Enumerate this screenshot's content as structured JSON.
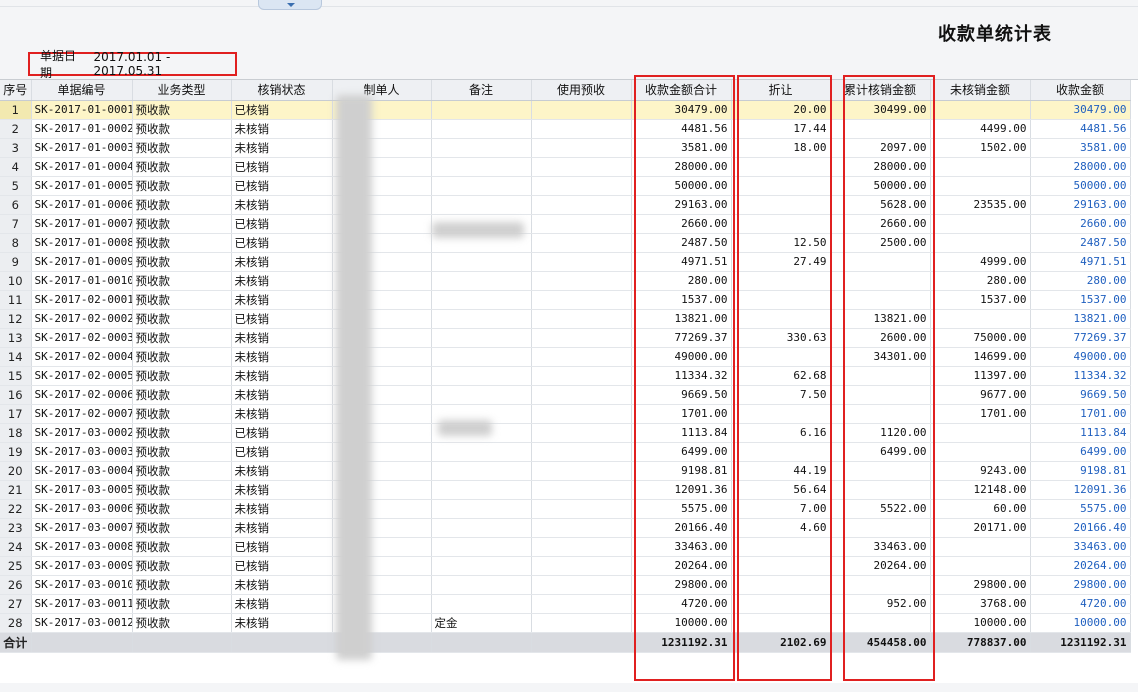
{
  "title": "收款单统计表",
  "filter": {
    "label": "单据日期",
    "value": "2017.01.01 - 2017.05.31"
  },
  "columns": [
    "序号",
    "单据编号",
    "业务类型",
    "核销状态",
    "制单人",
    "备注",
    "使用预收",
    "收款金额合计",
    "折让",
    "累计核销金额",
    "未核销金额",
    "收款金额"
  ],
  "rows": [
    {
      "seq": "1",
      "code": "SK-2017-01-0001",
      "type": "预收款",
      "status": "已核销",
      "maker": "",
      "note": "",
      "prepay": "",
      "total": "30479.00",
      "discount": "20.00",
      "verified": "30499.00",
      "unverified": "",
      "amount": "30479.00"
    },
    {
      "seq": "2",
      "code": "SK-2017-01-0002",
      "type": "预收款",
      "status": "未核销",
      "maker": "",
      "note": "",
      "prepay": "",
      "total": "4481.56",
      "discount": "17.44",
      "verified": "",
      "unverified": "4499.00",
      "amount": "4481.56"
    },
    {
      "seq": "3",
      "code": "SK-2017-01-0003",
      "type": "预收款",
      "status": "未核销",
      "maker": "",
      "note": "",
      "prepay": "",
      "total": "3581.00",
      "discount": "18.00",
      "verified": "2097.00",
      "unverified": "1502.00",
      "amount": "3581.00"
    },
    {
      "seq": "4",
      "code": "SK-2017-01-0004",
      "type": "预收款",
      "status": "已核销",
      "maker": "",
      "note": "",
      "prepay": "",
      "total": "28000.00",
      "discount": "",
      "verified": "28000.00",
      "unverified": "",
      "amount": "28000.00"
    },
    {
      "seq": "5",
      "code": "SK-2017-01-0005",
      "type": "预收款",
      "status": "已核销",
      "maker": "",
      "note": "",
      "prepay": "",
      "total": "50000.00",
      "discount": "",
      "verified": "50000.00",
      "unverified": "",
      "amount": "50000.00"
    },
    {
      "seq": "6",
      "code": "SK-2017-01-0006",
      "type": "预收款",
      "status": "未核销",
      "maker": "",
      "note": "",
      "prepay": "",
      "total": "29163.00",
      "discount": "",
      "verified": "5628.00",
      "unverified": "23535.00",
      "amount": "29163.00"
    },
    {
      "seq": "7",
      "code": "SK-2017-01-0007",
      "type": "预收款",
      "status": "已核销",
      "maker": "",
      "note": "",
      "prepay": "",
      "total": "2660.00",
      "discount": "",
      "verified": "2660.00",
      "unverified": "",
      "amount": "2660.00"
    },
    {
      "seq": "8",
      "code": "SK-2017-01-0008",
      "type": "预收款",
      "status": "已核销",
      "maker": "",
      "note": "",
      "prepay": "",
      "total": "2487.50",
      "discount": "12.50",
      "verified": "2500.00",
      "unverified": "",
      "amount": "2487.50"
    },
    {
      "seq": "9",
      "code": "SK-2017-01-0009",
      "type": "预收款",
      "status": "未核销",
      "maker": "",
      "note": "",
      "prepay": "",
      "total": "4971.51",
      "discount": "27.49",
      "verified": "",
      "unverified": "4999.00",
      "amount": "4971.51"
    },
    {
      "seq": "10",
      "code": "SK-2017-01-0010",
      "type": "预收款",
      "status": "未核销",
      "maker": "",
      "note": "",
      "prepay": "",
      "total": "280.00",
      "discount": "",
      "verified": "",
      "unverified": "280.00",
      "amount": "280.00"
    },
    {
      "seq": "11",
      "code": "SK-2017-02-0001",
      "type": "预收款",
      "status": "未核销",
      "maker": "",
      "note": "",
      "prepay": "",
      "total": "1537.00",
      "discount": "",
      "verified": "",
      "unverified": "1537.00",
      "amount": "1537.00"
    },
    {
      "seq": "12",
      "code": "SK-2017-02-0002",
      "type": "预收款",
      "status": "已核销",
      "maker": "",
      "note": "",
      "prepay": "",
      "total": "13821.00",
      "discount": "",
      "verified": "13821.00",
      "unverified": "",
      "amount": "13821.00"
    },
    {
      "seq": "13",
      "code": "SK-2017-02-0003",
      "type": "预收款",
      "status": "未核销",
      "maker": "",
      "note": "",
      "prepay": "",
      "total": "77269.37",
      "discount": "330.63",
      "verified": "2600.00",
      "unverified": "75000.00",
      "amount": "77269.37"
    },
    {
      "seq": "14",
      "code": "SK-2017-02-0004",
      "type": "预收款",
      "status": "未核销",
      "maker": "",
      "note": "",
      "prepay": "",
      "total": "49000.00",
      "discount": "",
      "verified": "34301.00",
      "unverified": "14699.00",
      "amount": "49000.00"
    },
    {
      "seq": "15",
      "code": "SK-2017-02-0005",
      "type": "预收款",
      "status": "未核销",
      "maker": "",
      "note": "",
      "prepay": "",
      "total": "11334.32",
      "discount": "62.68",
      "verified": "",
      "unverified": "11397.00",
      "amount": "11334.32"
    },
    {
      "seq": "16",
      "code": "SK-2017-02-0006",
      "type": "预收款",
      "status": "未核销",
      "maker": "",
      "note": "",
      "prepay": "",
      "total": "9669.50",
      "discount": "7.50",
      "verified": "",
      "unverified": "9677.00",
      "amount": "9669.50"
    },
    {
      "seq": "17",
      "code": "SK-2017-02-0007",
      "type": "预收款",
      "status": "未核销",
      "maker": "",
      "note": "",
      "prepay": "",
      "total": "1701.00",
      "discount": "",
      "verified": "",
      "unverified": "1701.00",
      "amount": "1701.00"
    },
    {
      "seq": "18",
      "code": "SK-2017-03-0002",
      "type": "预收款",
      "status": "已核销",
      "maker": "",
      "note": "",
      "prepay": "",
      "total": "1113.84",
      "discount": "6.16",
      "verified": "1120.00",
      "unverified": "",
      "amount": "1113.84"
    },
    {
      "seq": "19",
      "code": "SK-2017-03-0003",
      "type": "预收款",
      "status": "已核销",
      "maker": "",
      "note": "",
      "prepay": "",
      "total": "6499.00",
      "discount": "",
      "verified": "6499.00",
      "unverified": "",
      "amount": "6499.00"
    },
    {
      "seq": "20",
      "code": "SK-2017-03-0004",
      "type": "预收款",
      "status": "未核销",
      "maker": "",
      "note": "",
      "prepay": "",
      "total": "9198.81",
      "discount": "44.19",
      "verified": "",
      "unverified": "9243.00",
      "amount": "9198.81"
    },
    {
      "seq": "21",
      "code": "SK-2017-03-0005",
      "type": "预收款",
      "status": "未核销",
      "maker": "",
      "note": "",
      "prepay": "",
      "total": "12091.36",
      "discount": "56.64",
      "verified": "",
      "unverified": "12148.00",
      "amount": "12091.36"
    },
    {
      "seq": "22",
      "code": "SK-2017-03-0006",
      "type": "预收款",
      "status": "未核销",
      "maker": "",
      "note": "",
      "prepay": "",
      "total": "5575.00",
      "discount": "7.00",
      "verified": "5522.00",
      "unverified": "60.00",
      "amount": "5575.00"
    },
    {
      "seq": "23",
      "code": "SK-2017-03-0007",
      "type": "预收款",
      "status": "未核销",
      "maker": "",
      "note": "",
      "prepay": "",
      "total": "20166.40",
      "discount": "4.60",
      "verified": "",
      "unverified": "20171.00",
      "amount": "20166.40"
    },
    {
      "seq": "24",
      "code": "SK-2017-03-0008",
      "type": "预收款",
      "status": "已核销",
      "maker": "",
      "note": "",
      "prepay": "",
      "total": "33463.00",
      "discount": "",
      "verified": "33463.00",
      "unverified": "",
      "amount": "33463.00"
    },
    {
      "seq": "25",
      "code": "SK-2017-03-0009",
      "type": "预收款",
      "status": "已核销",
      "maker": "",
      "note": "",
      "prepay": "",
      "total": "20264.00",
      "discount": "",
      "verified": "20264.00",
      "unverified": "",
      "amount": "20264.00"
    },
    {
      "seq": "26",
      "code": "SK-2017-03-0010",
      "type": "预收款",
      "status": "未核销",
      "maker": "",
      "note": "",
      "prepay": "",
      "total": "29800.00",
      "discount": "",
      "verified": "",
      "unverified": "29800.00",
      "amount": "29800.00"
    },
    {
      "seq": "27",
      "code": "SK-2017-03-0011",
      "type": "预收款",
      "status": "未核销",
      "maker": "",
      "note": "",
      "prepay": "",
      "total": "4720.00",
      "discount": "",
      "verified": "952.00",
      "unverified": "3768.00",
      "amount": "4720.00"
    },
    {
      "seq": "28",
      "code": "SK-2017-03-0012",
      "type": "预收款",
      "status": "未核销",
      "maker": "",
      "note": "定金",
      "prepay": "",
      "total": "10000.00",
      "discount": "",
      "verified": "",
      "unverified": "10000.00",
      "amount": "10000.00"
    }
  ],
  "totals": {
    "label": "合计",
    "total": "1231192.31",
    "discount": "2102.69",
    "verified": "454458.00",
    "unverified": "778837.00",
    "amount": "1231192.31"
  },
  "colors": {
    "highlight_box": "#e02020",
    "amount_text": "#1f5fbf",
    "selected_row": "#fdf5c8"
  }
}
